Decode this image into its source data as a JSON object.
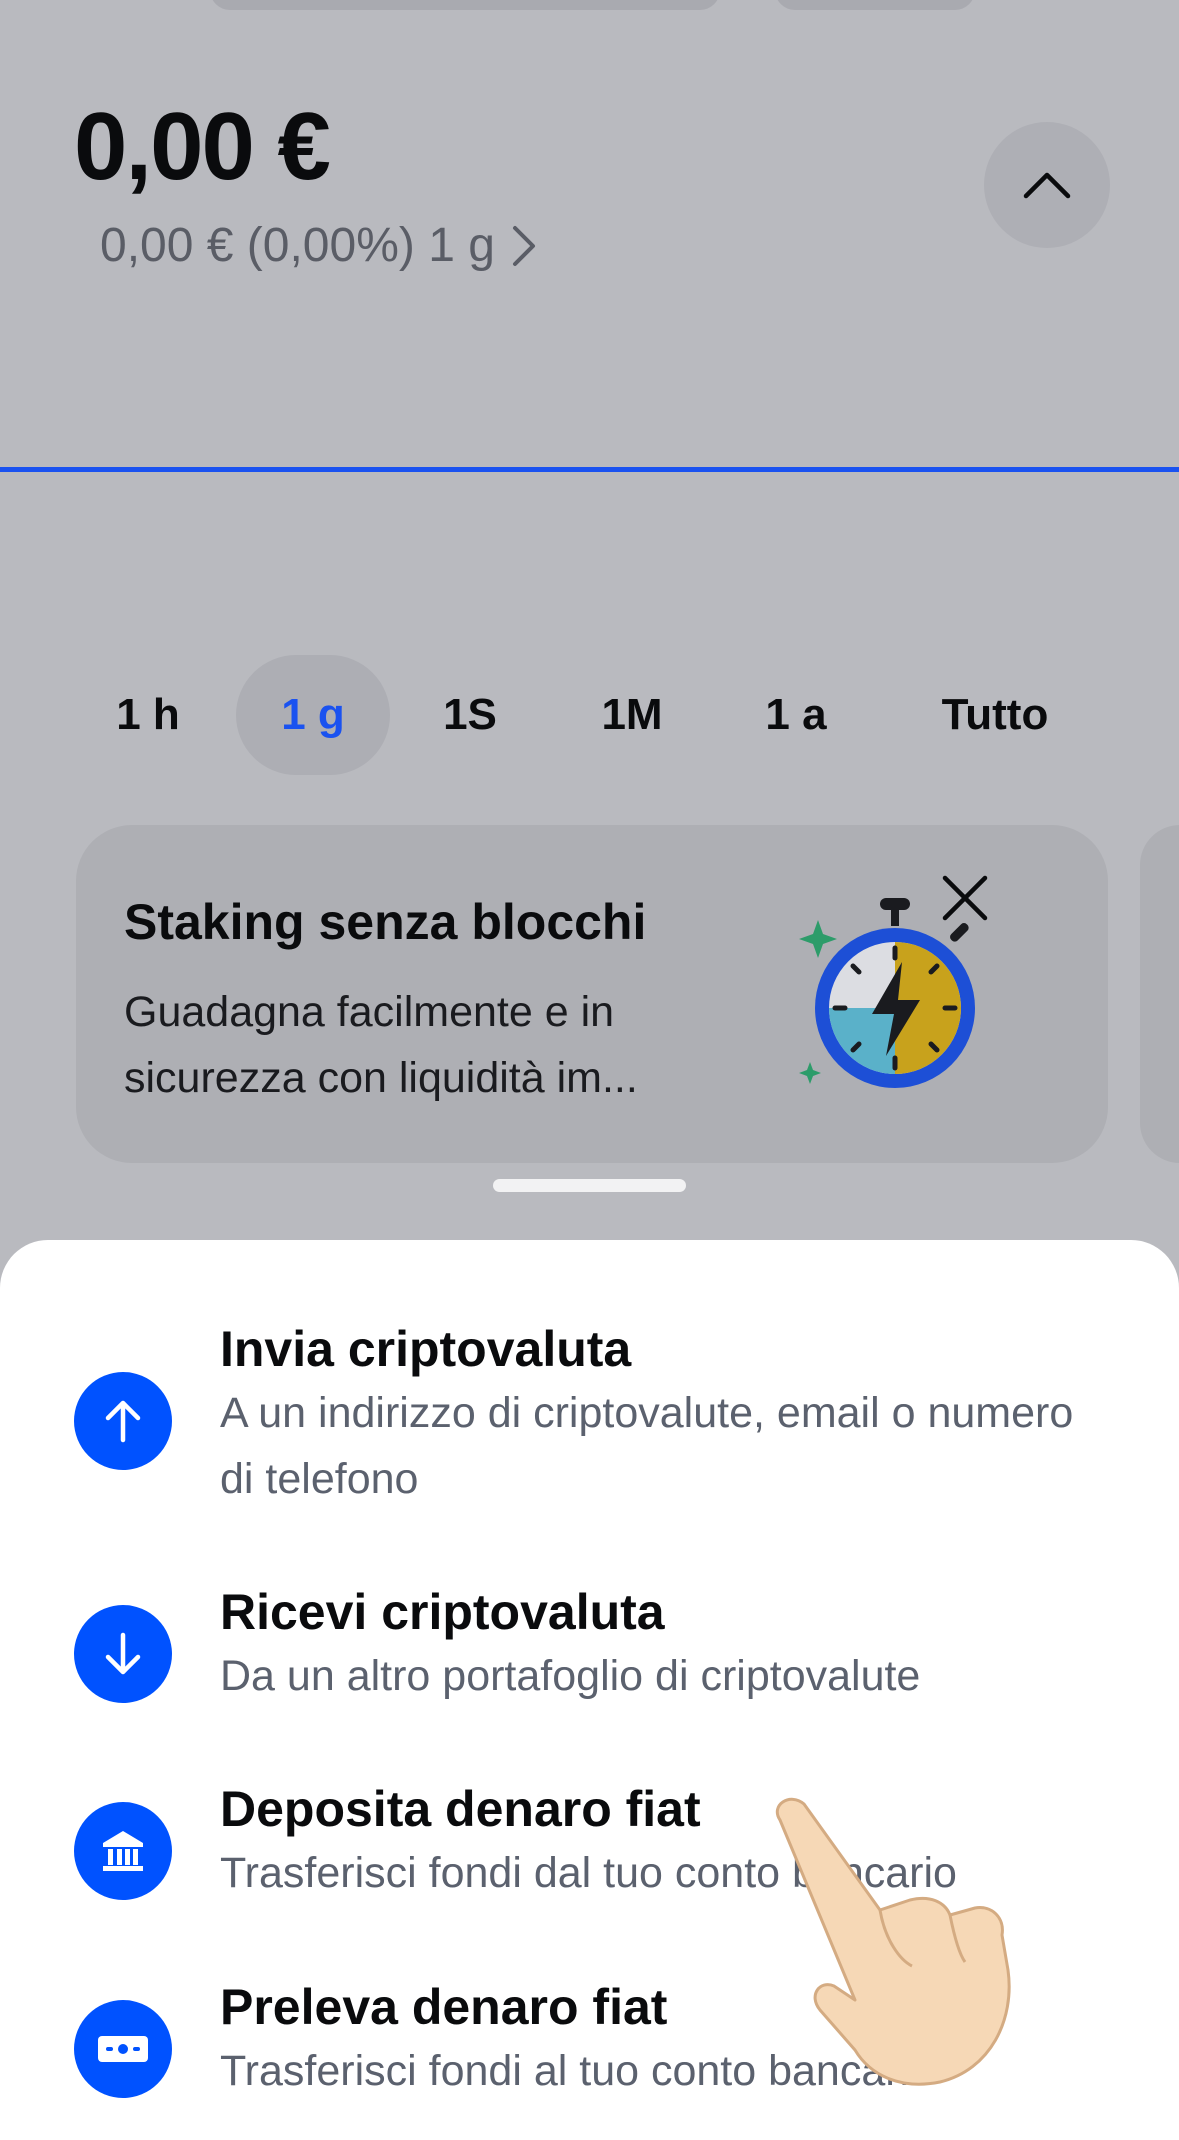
{
  "portfolio": {
    "balance": "0,00 €",
    "change": "0,00 € (0,00%) 1 g"
  },
  "timeframes": [
    "1 h",
    "1 g",
    "1S",
    "1M",
    "1 a",
    "Tutto"
  ],
  "selected_timeframe": "1 g",
  "promo_card": {
    "title": "Staking senza blocchi",
    "body": "Guadagna facilmente e in sicurezza con liquidità im..."
  },
  "action_sheet": {
    "items": [
      {
        "title": "Invia criptovaluta",
        "subtitle": "A un indirizzo di criptovalute, email o numero di telefono",
        "icon": "arrow-up-icon"
      },
      {
        "title": "Ricevi criptovaluta",
        "subtitle": "Da un altro portafoglio di criptovalute",
        "icon": "arrow-down-icon"
      },
      {
        "title": "Deposita denaro fiat",
        "subtitle": "Trasferisci fondi dal tuo conto bancario",
        "icon": "bank-icon"
      },
      {
        "title": "Preleva denaro fiat",
        "subtitle": "Trasferisci fondi al tuo conto bancario",
        "icon": "cash-icon"
      }
    ]
  },
  "colors": {
    "accent": "#0052ff",
    "chart_line": "#1a52f0",
    "overlay_background": "#b9babf"
  }
}
